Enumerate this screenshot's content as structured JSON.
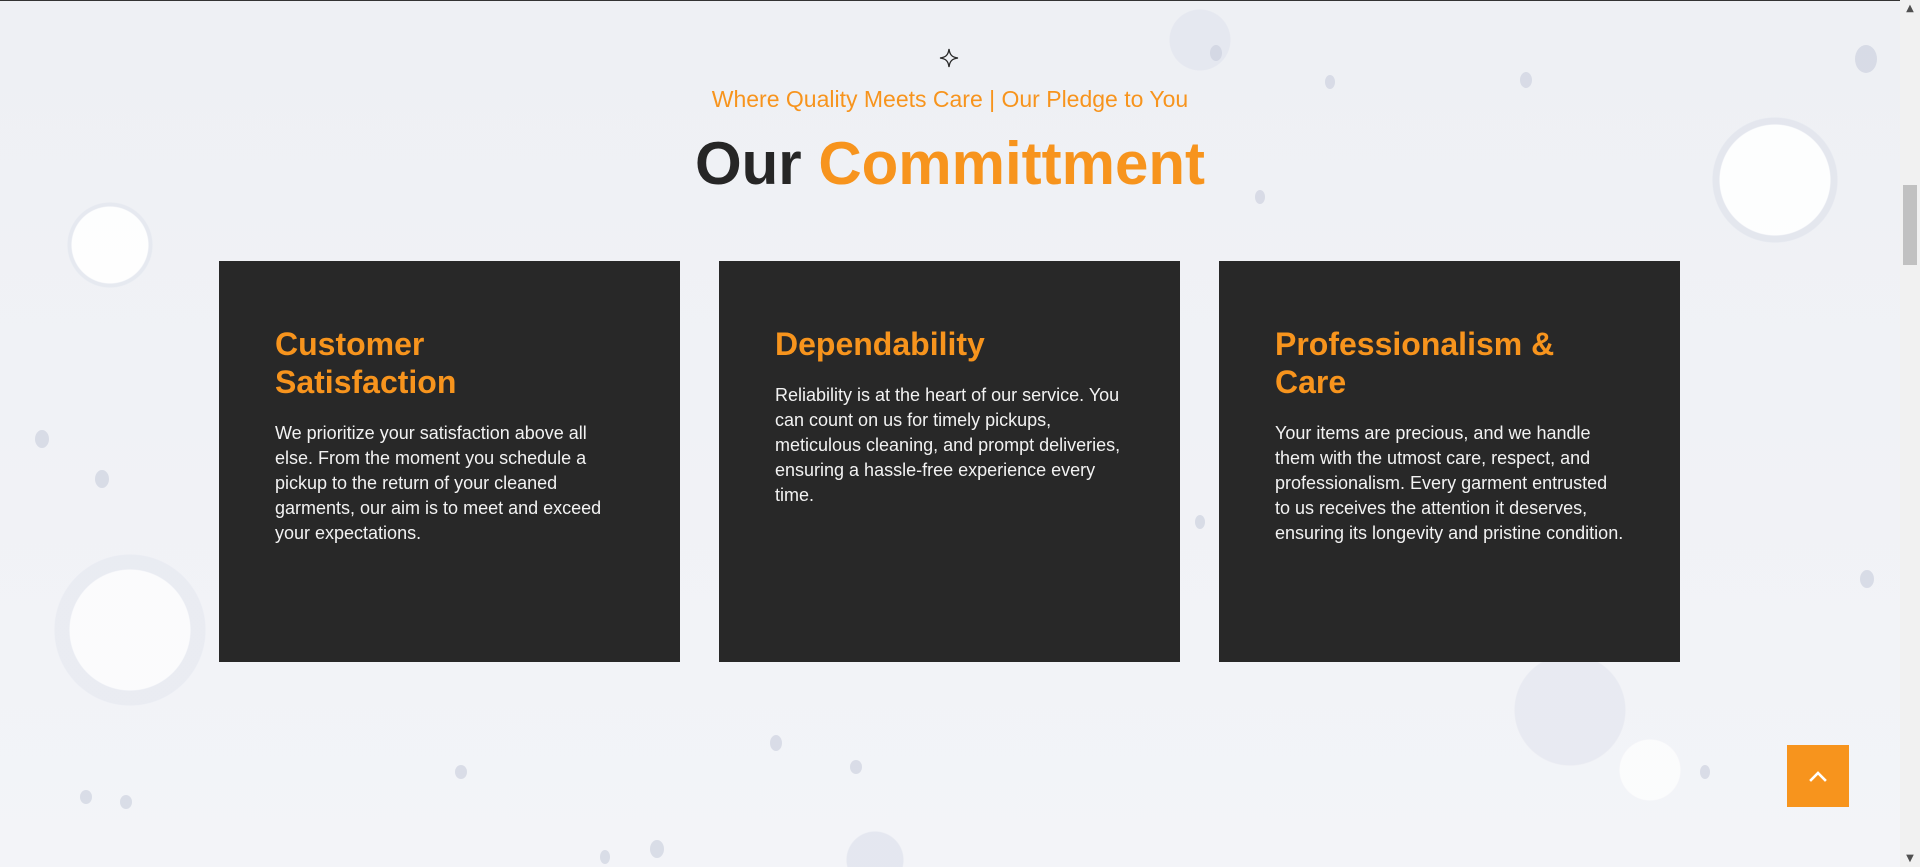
{
  "section": {
    "icon": "sparkle-icon",
    "subtitle": "Where Quality Meets Care | Our Pledge to You",
    "title_main": "Our",
    "title_accent": "Committment"
  },
  "cards": [
    {
      "title_line1": "Customer",
      "title_line2": "Satisfaction",
      "body": "We prioritize your satisfaction above all else. From the moment you schedule a pickup to the return of your cleaned garments, our aim is to meet and exceed your expectations."
    },
    {
      "title_line1": "Dependability",
      "title_line2": "",
      "body": "Reliability is at the heart of our service. You can count on us for timely pickups, meticulous cleaning, and prompt deliveries, ensuring a hassle-free experience every time."
    },
    {
      "title_line1": "Professionalism &",
      "title_line2": "Care",
      "body": "Your items are precious, and we handle them with the utmost care, respect, and professionalism. Every garment entrusted to us receives the attention it deserves, ensuring its longevity and pristine condition."
    }
  ],
  "back_to_top": {
    "icon": "chevron-up-icon"
  },
  "colors": {
    "accent": "#f7941d",
    "card_bg": "#282828",
    "title_dark": "#262626"
  }
}
